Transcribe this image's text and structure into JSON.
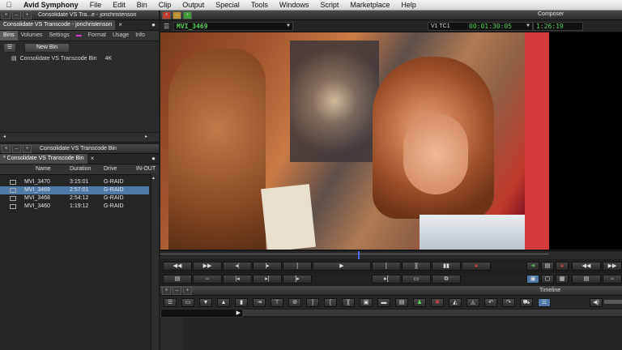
{
  "menubar": {
    "apple_icon": "",
    "app": "Avid Symphony",
    "items": [
      "File",
      "Edit",
      "Bin",
      "Clip",
      "Output",
      "Special",
      "Tools",
      "Windows",
      "Script",
      "Marketplace",
      "Help"
    ]
  },
  "project_window": {
    "title": "Consolidate VS Tra...e - jonchristenson",
    "doc_tab": "Consolidate VS Transcode - jonchristenson",
    "tabs": [
      "Bins",
      "Volumes",
      "Settings",
      "Format",
      "Usage",
      "Info"
    ],
    "new_bin_label": "New Bin",
    "bin_item": "Consolidate VS Transcode Bin",
    "bin_item_badge": "4K"
  },
  "bin_window": {
    "title": "Consolidate VS Transcode Bin",
    "tab": "* Consolidate VS Transcode Bin",
    "columns": [
      "Name",
      "Duration",
      "Drive",
      "IN-OUT"
    ],
    "rows": [
      {
        "name": "MVI_3470",
        "duration": "3:15:01",
        "drive": "G-RAID"
      },
      {
        "name": "MVI_3469",
        "duration": "2:57:01",
        "drive": "G-RAID"
      },
      {
        "name": "MVI_3468",
        "duration": "2:54:12",
        "drive": "G-RAID"
      },
      {
        "name": "MVI_3460",
        "duration": "1:19:12",
        "drive": "G-RAID"
      }
    ]
  },
  "composer": {
    "title": "Composer",
    "clip_name": "MVI_3469",
    "track_label": "V1  TC1",
    "timecode": "00:01:30:05",
    "duration": "1:26:19"
  },
  "timeline": {
    "title": "Timeline"
  },
  "colors": {
    "selection": "#4f7aa8",
    "timecode_green": "#58d05a",
    "playhead_blue": "#4a6cff"
  }
}
